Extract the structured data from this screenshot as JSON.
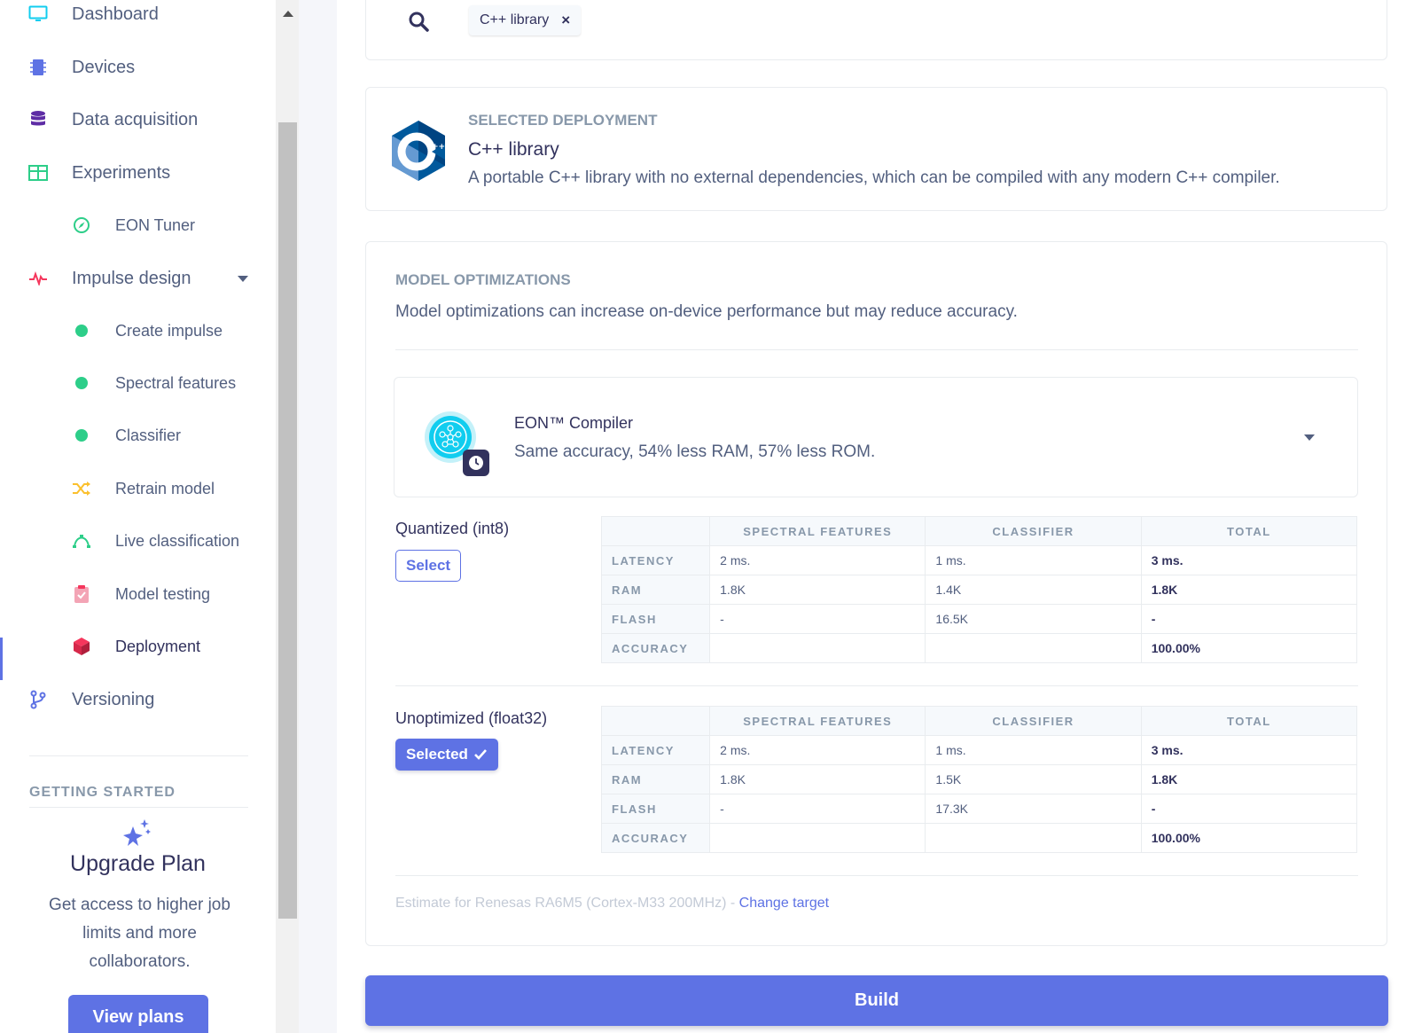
{
  "sidebar": {
    "items": [
      {
        "label": "Dashboard"
      },
      {
        "label": "Devices"
      },
      {
        "label": "Data acquisition"
      },
      {
        "label": "Experiments"
      },
      {
        "label": "EON Tuner"
      },
      {
        "label": "Impulse design"
      },
      {
        "label": "Create impulse"
      },
      {
        "label": "Spectral features"
      },
      {
        "label": "Classifier"
      },
      {
        "label": "Retrain model"
      },
      {
        "label": "Live classification"
      },
      {
        "label": "Model testing"
      },
      {
        "label": "Deployment"
      },
      {
        "label": "Versioning"
      }
    ],
    "getting_started": "GETTING STARTED",
    "upgrade": {
      "title": "Upgrade Plan",
      "text": "Get access to higher job limits and more collaborators.",
      "button": "View plans"
    }
  },
  "search": {
    "chip": "C++ library",
    "chip_remove": "×"
  },
  "deployment": {
    "heading": "SELECTED DEPLOYMENT",
    "title": "C++ library",
    "description": "A portable C++ library with no external dependencies, which can be compiled with any modern C++ compiler."
  },
  "optimizations": {
    "heading": "MODEL OPTIMIZATIONS",
    "description": "Model optimizations can increase on-device performance but may reduce accuracy.",
    "eon": {
      "title": "EON™ Compiler",
      "description": "Same accuracy, 54% less RAM, 57% less ROM."
    },
    "columns": [
      "SPECTRAL FEATURES",
      "CLASSIFIER",
      "TOTAL"
    ],
    "quantized": {
      "title": "Quantized (int8)",
      "button": "Select",
      "rows": [
        {
          "label": "LATENCY",
          "values": [
            "2 ms.",
            "1 ms.",
            "3 ms."
          ]
        },
        {
          "label": "RAM",
          "values": [
            "1.8K",
            "1.4K",
            "1.8K"
          ]
        },
        {
          "label": "FLASH",
          "values": [
            "-",
            "16.5K",
            "-"
          ]
        },
        {
          "label": "ACCURACY",
          "values": [
            "",
            "",
            "100.00%"
          ]
        }
      ]
    },
    "unoptimized": {
      "title": "Unoptimized (float32)",
      "button": "Selected",
      "rows": [
        {
          "label": "LATENCY",
          "values": [
            "2 ms.",
            "1 ms.",
            "3 ms."
          ]
        },
        {
          "label": "RAM",
          "values": [
            "1.8K",
            "1.5K",
            "1.8K"
          ]
        },
        {
          "label": "FLASH",
          "values": [
            "-",
            "17.3K",
            "-"
          ]
        },
        {
          "label": "ACCURACY",
          "values": [
            "",
            "",
            "100.00%"
          ]
        }
      ]
    },
    "estimate": "Estimate for Renesas RA6M5 (Cortex-M33 200MHz) - ",
    "change_target": "Change target"
  },
  "build_button": "Build",
  "colors": {
    "accent": "#5e72e4",
    "success": "#2dce89"
  }
}
